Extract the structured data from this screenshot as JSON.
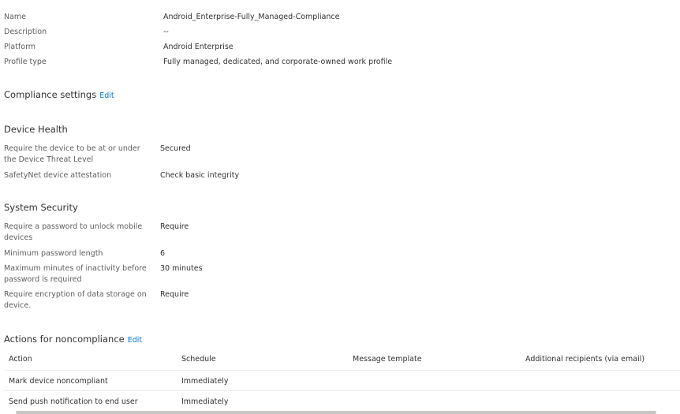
{
  "properties": [
    {
      "label": "Name",
      "value": "Android_Enterprise-Fully_Managed-Compliance"
    },
    {
      "label": "Description",
      "value": "--"
    },
    {
      "label": "Platform",
      "value": "Android Enterprise"
    },
    {
      "label": "Profile type",
      "value": "Fully managed, dedicated, and corporate-owned work profile"
    }
  ],
  "compliance": {
    "title": "Compliance settings",
    "edit_label": "Edit"
  },
  "device_health": {
    "title": "Device Health",
    "items": [
      {
        "label": "Require the device to be at or under the Device Threat Level",
        "value": "Secured"
      },
      {
        "label": "SafetyNet device attestation",
        "value": "Check basic integrity"
      }
    ]
  },
  "system_security": {
    "title": "System Security",
    "items": [
      {
        "label": "Require a password to unlock mobile devices",
        "value": "Require"
      },
      {
        "label": "Minimum password length",
        "value": "6"
      },
      {
        "label": "Maximum minutes of inactivity before password is required",
        "value": "30 minutes"
      },
      {
        "label": "Require encryption of data storage on device.",
        "value": "Require"
      }
    ]
  },
  "actions": {
    "title": "Actions for noncompliance",
    "edit_label": "Edit",
    "columns": [
      "Action",
      "Schedule",
      "Message template",
      "Additional recipients (via email)"
    ],
    "rows": [
      [
        "Mark device noncompliant",
        "Immediately",
        "",
        ""
      ],
      [
        "Send push notification to end user",
        "Immediately",
        "",
        ""
      ]
    ]
  }
}
